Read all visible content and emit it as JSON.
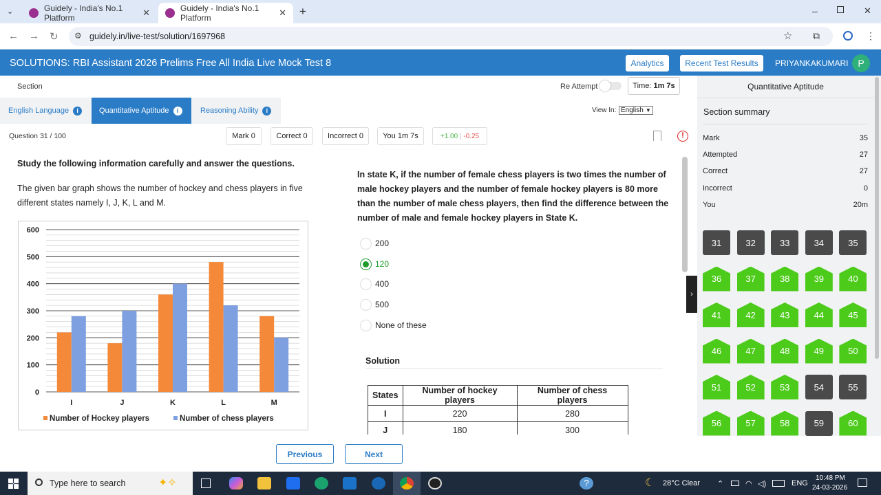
{
  "browser": {
    "tabs": [
      {
        "title": "Guidely - India's No.1 Platform"
      },
      {
        "title": "Guidely - India's No.1 Platform"
      }
    ],
    "url": "guidely.in/live-test/solution/1697968"
  },
  "header": {
    "title": "SOLUTIONS: RBI Assistant 2026 Prelims Free All India Live Mock Test 8",
    "analytics_label": "Analytics",
    "recent_label": "Recent Test Results",
    "username": "PRIYANKAKUMARI",
    "avatar_letter": "P"
  },
  "toolbar": {
    "section_label": "Section",
    "reattempt_label": "Re Attempt",
    "time_label": "Time:",
    "time_value": "1m 7s",
    "view_in_label": "View In:",
    "language": "English"
  },
  "sections": [
    {
      "label": "English Language"
    },
    {
      "label": "Quantitative Aptitude"
    },
    {
      "label": "Reasoning Ability"
    }
  ],
  "question_bar": {
    "number": "Question 31 / 100",
    "mark": "Mark  0",
    "correct": "Correct  0",
    "incorrect": "Incorrect  0",
    "you": "You  1m 7s",
    "plus": "+1.00",
    "minus": "-0.25"
  },
  "passage": {
    "heading": "Study the following information carefully and answer the questions.",
    "text": "The given bar graph shows the number of hockey and chess players in five different states namely I, J, K, L and M."
  },
  "chart_data": {
    "type": "bar",
    "categories": [
      "I",
      "J",
      "K",
      "L",
      "M"
    ],
    "series": [
      {
        "name": "Number of Hockey players",
        "color": "#f5893a",
        "values": [
          220,
          180,
          360,
          480,
          280
        ]
      },
      {
        "name": "Number of chess players",
        "color": "#7fa0e0",
        "values": [
          280,
          300,
          400,
          320,
          200
        ]
      }
    ],
    "ylim": [
      0,
      600
    ],
    "yticks": [
      0,
      100,
      200,
      300,
      400,
      500,
      600
    ],
    "grid": true,
    "legend": "bottom"
  },
  "question": {
    "text": "In state K, if the number of female chess players is two times the number of male hockey players and the number of female hockey players is 80 more than the number of male chess players, then find the difference between the number of male and female hockey players in State K.",
    "options": [
      "200",
      "120",
      "400",
      "500",
      "None of these"
    ],
    "selected": "120"
  },
  "solution": {
    "heading": "Solution",
    "headers": [
      "States",
      "Number of hockey players",
      "Number of chess players"
    ],
    "rows": [
      [
        "I",
        "220",
        "280"
      ],
      [
        "J",
        "180",
        "300"
      ]
    ]
  },
  "summary": {
    "section_title": "Quantitative Aptitude",
    "title": "Section summary",
    "rows": [
      {
        "label": "Mark",
        "value": "35"
      },
      {
        "label": "Attempted",
        "value": "27"
      },
      {
        "label": "Correct",
        "value": "27"
      },
      {
        "label": "Incorrect",
        "value": "0"
      },
      {
        "label": "You",
        "value": "20m"
      }
    ],
    "questions": [
      {
        "n": "31",
        "s": "gray"
      },
      {
        "n": "32",
        "s": "gray"
      },
      {
        "n": "33",
        "s": "gray"
      },
      {
        "n": "34",
        "s": "gray"
      },
      {
        "n": "35",
        "s": "gray"
      },
      {
        "n": "36",
        "s": "green"
      },
      {
        "n": "37",
        "s": "green"
      },
      {
        "n": "38",
        "s": "green"
      },
      {
        "n": "39",
        "s": "green"
      },
      {
        "n": "40",
        "s": "green"
      },
      {
        "n": "41",
        "s": "green"
      },
      {
        "n": "42",
        "s": "green"
      },
      {
        "n": "43",
        "s": "green"
      },
      {
        "n": "44",
        "s": "green"
      },
      {
        "n": "45",
        "s": "green"
      },
      {
        "n": "46",
        "s": "green"
      },
      {
        "n": "47",
        "s": "green"
      },
      {
        "n": "48",
        "s": "green"
      },
      {
        "n": "49",
        "s": "green"
      },
      {
        "n": "50",
        "s": "green"
      },
      {
        "n": "51",
        "s": "green"
      },
      {
        "n": "52",
        "s": "green"
      },
      {
        "n": "53",
        "s": "green"
      },
      {
        "n": "54",
        "s": "gray"
      },
      {
        "n": "55",
        "s": "gray"
      },
      {
        "n": "56",
        "s": "green"
      },
      {
        "n": "57",
        "s": "green"
      },
      {
        "n": "58",
        "s": "green"
      },
      {
        "n": "59",
        "s": "gray"
      },
      {
        "n": "60",
        "s": "green"
      }
    ]
  },
  "footer": {
    "previous_label": "Previous",
    "next_label": "Next"
  },
  "taskbar": {
    "search_placeholder": "Type here to search",
    "weather": "28°C  Clear",
    "lang": "ENG",
    "time": "10:48 PM",
    "date": "24-03-2026"
  }
}
